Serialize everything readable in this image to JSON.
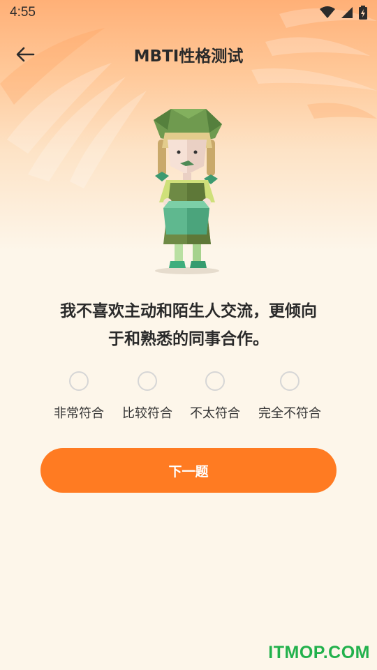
{
  "status_bar": {
    "time": "4:55",
    "icons": [
      "wifi-icon",
      "signal-icon",
      "battery-charging-icon"
    ]
  },
  "header": {
    "title": "MBTI性格测试",
    "back_icon": "arrow-left-icon"
  },
  "question": {
    "line1": "我不喜欢主动和陌生人交流，更倾向",
    "line2": "于和熟悉的同事合作。"
  },
  "options": [
    {
      "label": "非常符合",
      "selected": false
    },
    {
      "label": "比较符合",
      "selected": false
    },
    {
      "label": "不太符合",
      "selected": false
    },
    {
      "label": "完全不符合",
      "selected": false
    }
  ],
  "next_button": {
    "label": "下一题"
  },
  "watermark": {
    "text": "ITMOP.COM"
  },
  "colors": {
    "accent": "#ff7b22",
    "background": "#fdf6ea",
    "header_gradient_top": "#ffb077",
    "radio_border": "#d6d6d6",
    "watermark": "#22b14c"
  }
}
